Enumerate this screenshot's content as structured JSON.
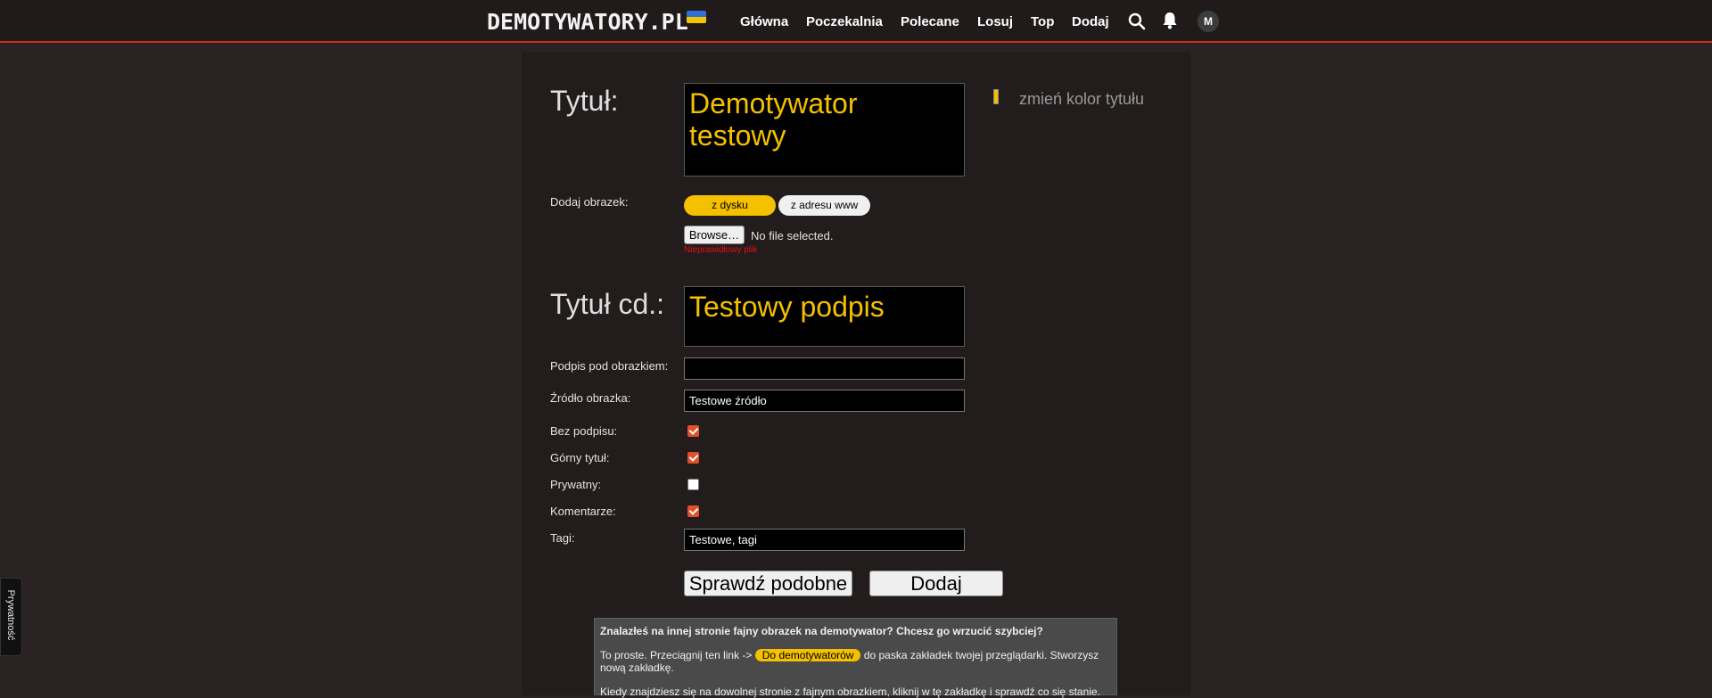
{
  "header": {
    "logo_text": "DEMOTYWATORY.PL",
    "nav": [
      "Główna",
      "Poczekalnia",
      "Polecane",
      "Losuj",
      "Top",
      "Dodaj"
    ],
    "avatar_initial": "M"
  },
  "form": {
    "title_label": "Tytuł:",
    "title_value": "Demotywator testowy",
    "title_color_link": "zmień kolor tytułu",
    "title_color_swatch": "#f4c000",
    "add_image_label": "Dodaj obrazek:",
    "source_toggle": {
      "disk": "z dysku",
      "www": "z adresu www"
    },
    "file_button": "Browse…",
    "file_status": "No file selected.",
    "file_error": "Nieprawidłowy plik",
    "title_cont_label": "Tytuł cd.:",
    "title_cont_value": "Testowy podpis",
    "caption_label": "Podpis pod obrazkiem:",
    "caption_value": "",
    "source_label": "Źródło obrazka:",
    "source_value": "Testowe źródło",
    "no_caption_label": "Bez podpisu:",
    "no_caption_checked": true,
    "top_title_label": "Górny tytuł:",
    "top_title_checked": true,
    "private_label": "Prywatny:",
    "private_checked": false,
    "comments_label": "Komentarze:",
    "comments_checked": true,
    "tags_label": "Tagi:",
    "tags_value": "Testowe, tagi",
    "check_similar_button": "Sprawdź podobne",
    "submit_button": "Dodaj"
  },
  "info_box": {
    "heading": "Znalazłeś na innej stronie fajny obrazek na demotywator? Chcesz go wrzucić szybciej?",
    "line1_before": "To proste. Przeciągnij ten link ->",
    "bookmarklet_label": "Do demotywatorów",
    "line1_after": "do paska zakładek twojej przeglądarki. Stworzysz nową zakładkę.",
    "line2": "Kiedy znajdziesz się na dowolnej stronie z fajnym obrazkiem, kliknij w tę zakładkę i sprawdź co się stanie."
  },
  "privacy_tab": "Prywatność",
  "colors": {
    "accent_yellow": "#f4c000",
    "topbar_border": "#c8321e",
    "checkbox": "#e0502a"
  }
}
